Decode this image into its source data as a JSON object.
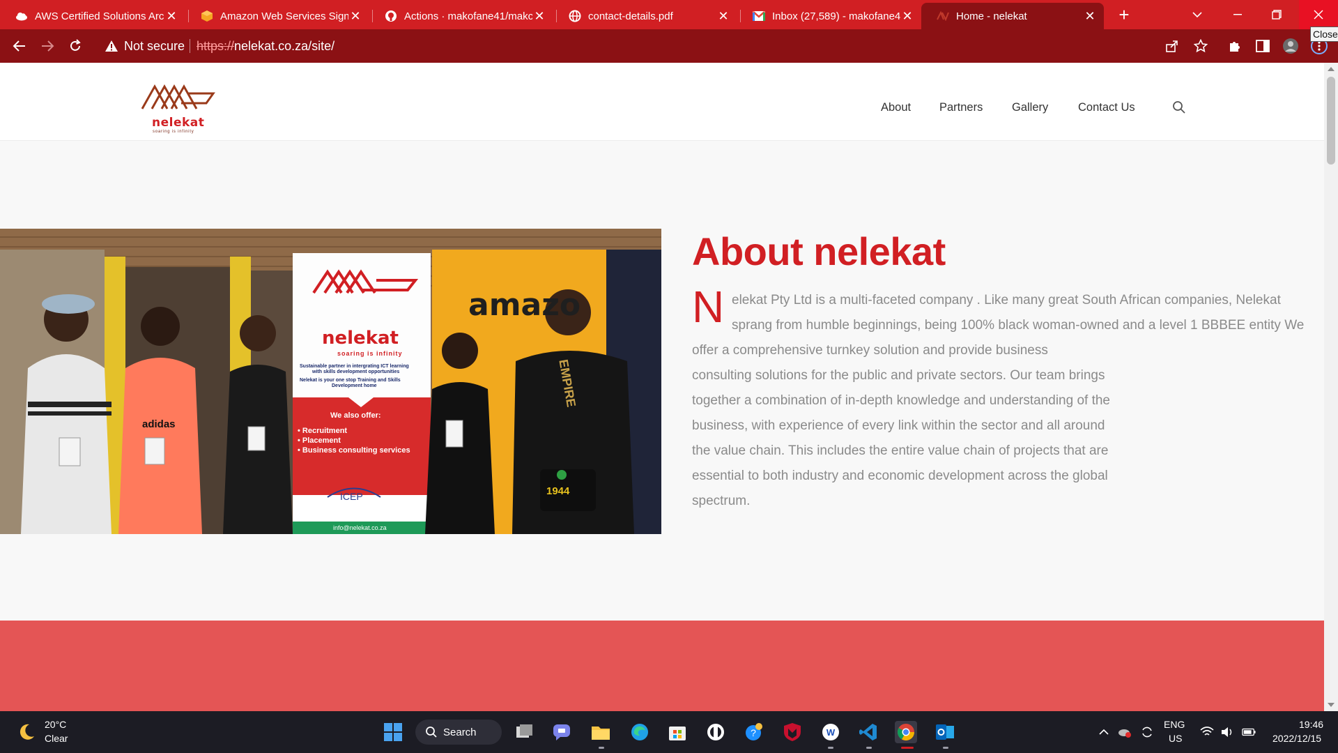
{
  "browser": {
    "tabs": [
      {
        "title": "AWS Certified Solutions Arc",
        "icon": "cloud-icon"
      },
      {
        "title": "Amazon Web Services Sign",
        "icon": "aws-box-icon"
      },
      {
        "title": "Actions · makofane41/makc",
        "icon": "github-icon"
      },
      {
        "title": "contact-details.pdf",
        "icon": "globe-icon"
      },
      {
        "title": "Inbox (27,589) - makofane4",
        "icon": "gmail-icon"
      },
      {
        "title": "Home - nelekat",
        "icon": "nelekat-favicon",
        "active": true
      }
    ],
    "new_tab_label": "+",
    "close_tooltip": "Close",
    "security_label": "Not secure",
    "url_scheme": "https://",
    "url_rest": "nelekat.co.za/site/"
  },
  "site": {
    "logo_text": "nelekat",
    "logo_tagline": "soaring is infinity",
    "menu": [
      "About",
      "Partners",
      "Gallery",
      "Contact Us"
    ]
  },
  "about": {
    "title": "About nelekat",
    "dropcap": "N",
    "lines": [
      "elekat Pty Ltd is a multi-faceted company . Like many great South African companies, Nelekat",
      "sprang from humble beginnings, being 100% black woman-owned and a level 1 BBBEE entity We",
      "offer a comprehensive turnkey solution and provide business",
      "consulting solutions for the public and private sectors. Our team brings",
      "together a combination of in-depth knowledge and understanding of the",
      "business, with experience of every link within the sector and all around",
      "the value chain. This includes the entire value chain of projects that are",
      "essential to both industry and economic development across the global",
      "spectrum."
    ]
  },
  "photo": {
    "banner_brand": "nelekat",
    "banner_tagline": "soaring is infinity",
    "banner_desc1": "Sustainable partner in intergrating ICT learning",
    "banner_desc2": "with skills development opportunities",
    "banner_desc3": "Nelekat is your one stop Training and Skills",
    "banner_desc4": "Development home",
    "offer_title": "We also offer:",
    "offer_items": [
      "• Recruitment",
      "• Placement",
      "• Business consulting services"
    ],
    "icep_label": "ICEP",
    "email": "info@nelekat.co.za",
    "backdrop_word": "amazo",
    "shirt_left": "adidas",
    "shirt_right": "EMPIRE",
    "bag_text": "1944"
  },
  "taskbar": {
    "temperature": "20°C",
    "condition": "Clear",
    "search_label": "Search",
    "lang_primary": "ENG",
    "lang_secondary": "US",
    "time": "19:46",
    "date": "2022/12/15"
  },
  "colors": {
    "brand_red": "#d11f23",
    "toolbar_dark_red": "#8b1114",
    "band_red": "#e45555",
    "text_grey": "#8a8a8a"
  }
}
